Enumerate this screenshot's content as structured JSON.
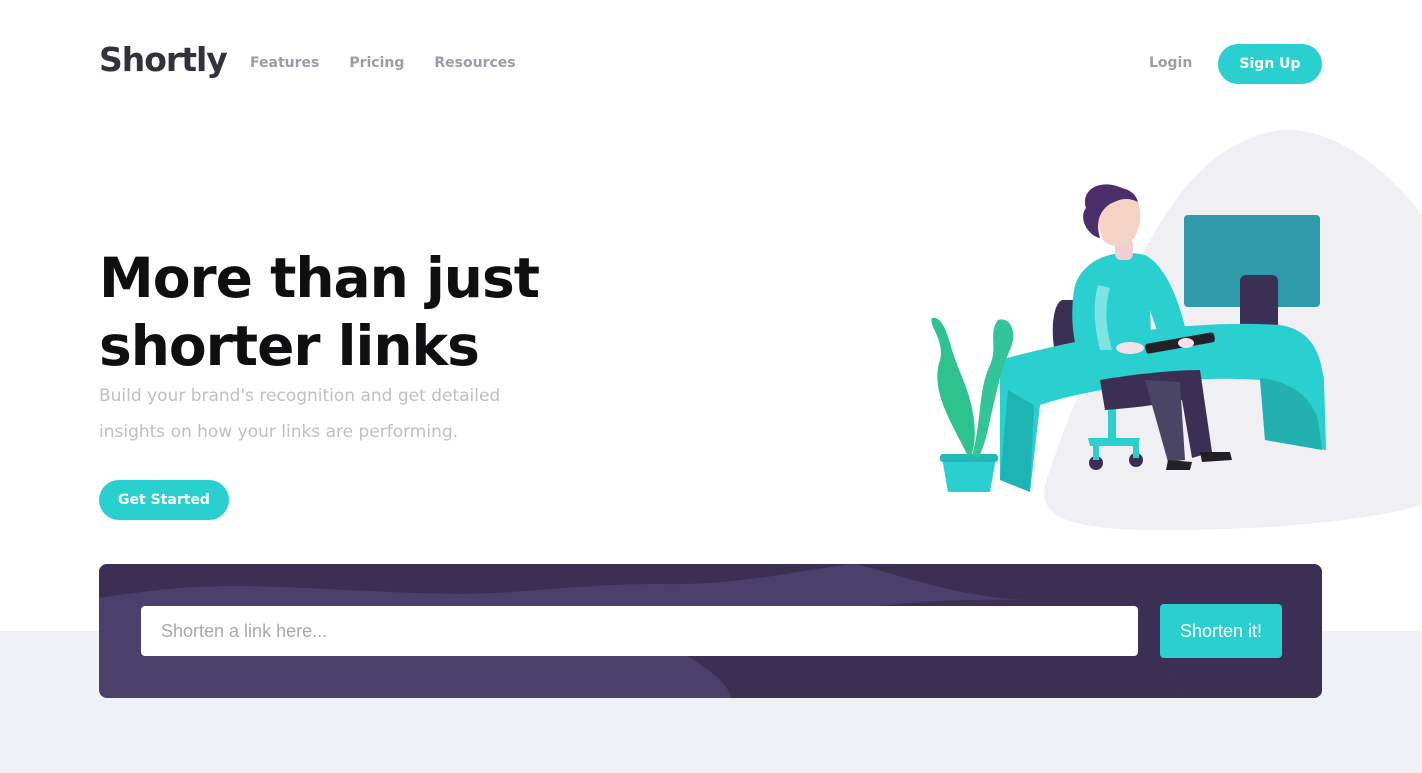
{
  "brand": {
    "name": "Shortly"
  },
  "nav": {
    "links": [
      "Features",
      "Pricing",
      "Resources"
    ],
    "login": "Login",
    "signup": "Sign Up"
  },
  "hero": {
    "title": "More than just shorter links",
    "subtitle": "Build your brand's recognition and get detailed insights on how your links are performing.",
    "cta": "Get Started"
  },
  "shorten": {
    "placeholder": "Shorten a link here...",
    "button": "Shorten it!"
  },
  "colors": {
    "accent": "#2acfcf",
    "dark_violet": "#3b3054",
    "box_violet": "#4b3f6b",
    "grayish_violet": "#9e9aa7",
    "light_bg": "#f0f1f6"
  },
  "icons": {
    "hero_illustration": "person-working-at-desk-illustration"
  }
}
